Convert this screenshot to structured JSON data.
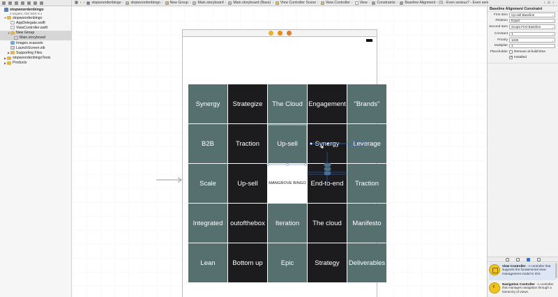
{
  "jumpbar": {
    "crumbs": [
      {
        "label": "stopwoordenbingo",
        "color": "#5c7fbf"
      },
      {
        "label": "stopwoordenbingo",
        "color": "#e0b54c"
      },
      {
        "label": "New Group",
        "color": "#e0b54c"
      },
      {
        "label": "Main.storyboard",
        "color": "#bcbcbc"
      },
      {
        "label": "Main.storyboard (Base)",
        "color": "#bcbcbc"
      },
      {
        "label": "View Controller Scene",
        "color": "#f0c419"
      },
      {
        "label": "View Controller",
        "color": "#f0c419"
      },
      {
        "label": "View",
        "color": "#ffffff"
      },
      {
        "label": "Constraints",
        "color": "#9a9a9a"
      },
      {
        "label": "Baseline Alignment - (1) - Even serieus? - Even serieus?",
        "color": "#9a9a9a"
      }
    ]
  },
  "navigator": {
    "project_name": "stopwoordenbingo",
    "project_subtitle": "2 targets, iOS SDK 8.1",
    "items": [
      {
        "label": "stopwoordenbingo",
        "type": "folder",
        "indent": 1,
        "disclosure": "▼"
      },
      {
        "label": "AppDelegate.swift",
        "type": "swift",
        "indent": 2,
        "disclosure": ""
      },
      {
        "label": "ViewController.swift",
        "type": "swift",
        "indent": 2,
        "disclosure": ""
      },
      {
        "label": "New Group",
        "type": "folder",
        "indent": 2,
        "disclosure": "▼",
        "selected": true
      },
      {
        "label": "Main.storyboard",
        "type": "storyboard",
        "indent": 3,
        "disclosure": "",
        "selected": true
      },
      {
        "label": "Images.xcassets",
        "type": "xcassets",
        "indent": 2,
        "disclosure": ""
      },
      {
        "label": "LaunchScreen.xib",
        "type": "storyboard",
        "indent": 2,
        "disclosure": ""
      },
      {
        "label": "Supporting Files",
        "type": "folder",
        "indent": 2,
        "disclosure": "▶"
      },
      {
        "label": "stopwoordenbingoTests",
        "type": "folder",
        "indent": 1,
        "disclosure": "▶"
      },
      {
        "label": "Products",
        "type": "folder",
        "indent": 1,
        "disclosure": "▶"
      }
    ]
  },
  "canvas": {
    "tiles": [
      {
        "label": "Synergy",
        "style": "slate"
      },
      {
        "label": "Strategize",
        "style": "black"
      },
      {
        "label": "The Cloud",
        "style": "slate"
      },
      {
        "label": "Engagement",
        "style": "black"
      },
      {
        "label": "\"Brands\"",
        "style": "slate"
      },
      {
        "label": "B2B",
        "style": "slate"
      },
      {
        "label": "Traction",
        "style": "black"
      },
      {
        "label": "Up-sell",
        "style": "slate"
      },
      {
        "label": "Synergy",
        "style": "black"
      },
      {
        "label": "Leverage",
        "style": "slate"
      },
      {
        "label": "Scale",
        "style": "slate"
      },
      {
        "label": "Up-sell",
        "style": "black"
      },
      {
        "label": "MANGROVE BINGO",
        "style": "white"
      },
      {
        "label": "End-to-end",
        "style": "black"
      },
      {
        "label": "Traction",
        "style": "slate"
      },
      {
        "label": "Integrated",
        "style": "slate"
      },
      {
        "label": "outofthebox",
        "style": "black"
      },
      {
        "label": "Iteration",
        "style": "slate"
      },
      {
        "label": "The cloud",
        "style": "black"
      },
      {
        "label": "Manifesto",
        "style": "slate"
      },
      {
        "label": "Lean",
        "style": "slate"
      },
      {
        "label": "Bottom up",
        "style": "black"
      },
      {
        "label": "Epic",
        "style": "slate"
      },
      {
        "label": "Strategy",
        "style": "black"
      },
      {
        "label": "Deliverables",
        "style": "slate"
      }
    ],
    "dock_icons": [
      {
        "name": "view-controller-dock-icon",
        "color": "#f0b21a"
      },
      {
        "name": "first-responder-dock-icon",
        "color": "#f08a1a"
      },
      {
        "name": "exit-dock-icon",
        "color": "#e87a2a"
      }
    ]
  },
  "inspector": {
    "title": "Baseline Alignment Constraint",
    "first_item_label": "First Item",
    "first_item_value": "Up-sell.Baseline",
    "relation_label": "Relation",
    "relation_value": "Equal",
    "second_item_label": "Second Item",
    "second_item_value": "Scope.First Baseline",
    "constant_label": "Constant",
    "constant_value": "1",
    "priority_label": "Priority",
    "priority_value": "1000",
    "multiplier_label": "Multiplier",
    "multiplier_value": "1",
    "placeholder_label": "Placeholder",
    "placeholder_check": "Remove at build time",
    "installed_label": "Installed"
  },
  "library": {
    "items": [
      {
        "title": "View Controller",
        "desc": " - A controller that supports the fundamental view-management model in iOS.",
        "icon": "view-controller-icon"
      },
      {
        "title": "Navigation Controller",
        "desc": " - A controller that manages navigation through a hierarchy of views.",
        "icon": "navigation-controller-icon"
      }
    ]
  }
}
